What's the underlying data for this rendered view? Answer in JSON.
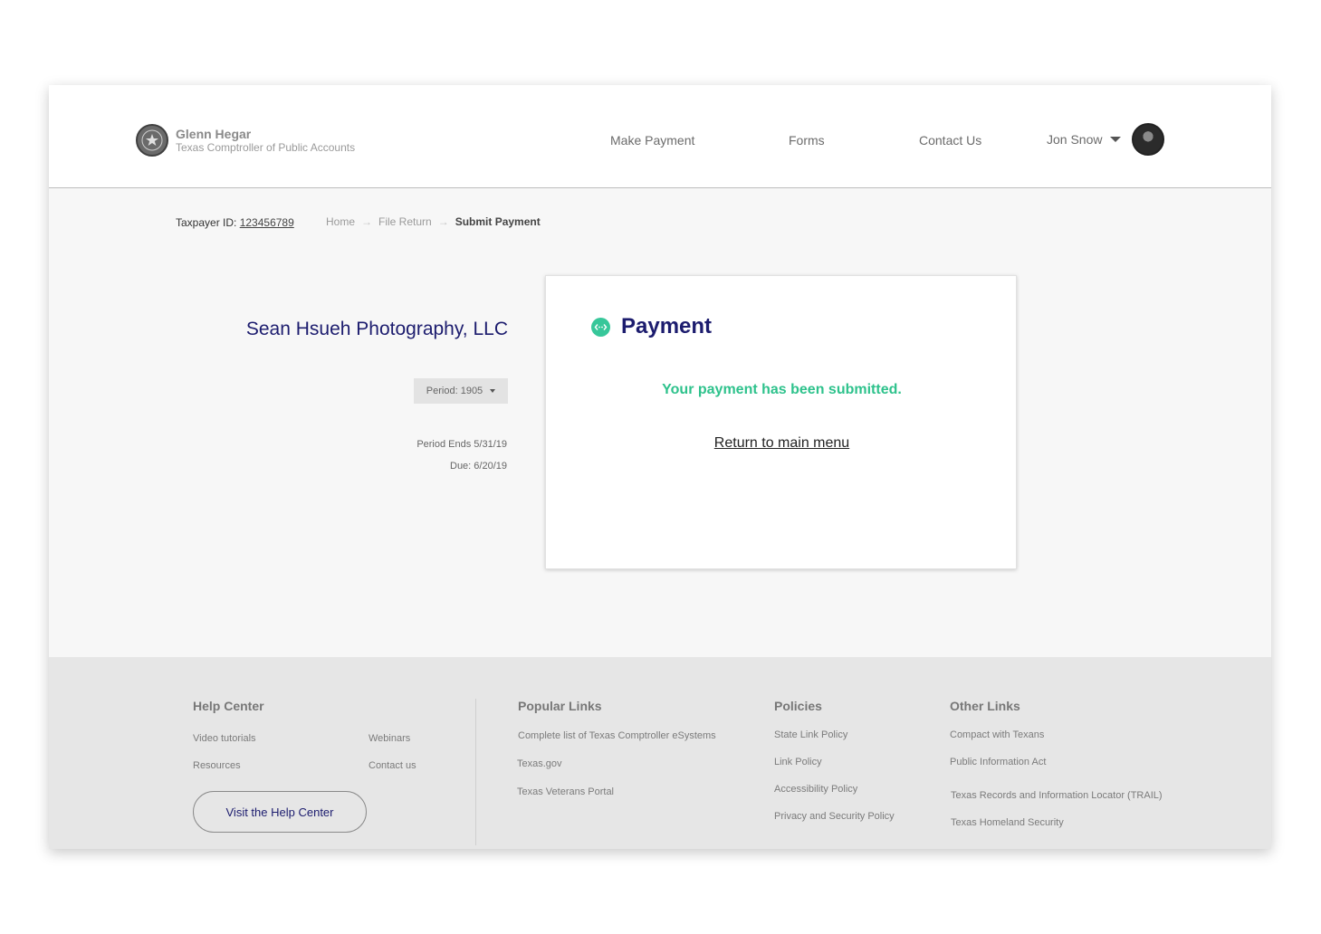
{
  "header": {
    "brand_name": "Glenn Hegar",
    "brand_sub": "Texas Comptroller of Public Accounts",
    "nav": [
      "Make Payment",
      "Forms",
      "Contact Us"
    ],
    "user_name": "Jon Snow"
  },
  "breadcrumb": {
    "taxpayer_label": "Taxpayer ID:",
    "taxpayer_id": "123456789",
    "items": [
      "Home",
      "File Return"
    ],
    "current": "Submit Payment"
  },
  "account": {
    "company": "Sean Hsueh Photography, LLC",
    "period_label": "Period: 1905",
    "period_ends": "Period Ends 5/31/19",
    "due": "Due: 6/20/19"
  },
  "card": {
    "title": "Payment",
    "success_message": "Your payment has been submitted.",
    "return_link": "Return to main menu"
  },
  "footer": {
    "help_center": {
      "title": "Help Center",
      "links": [
        "Video tutorials",
        "Webinars",
        "Resources",
        "Contact us"
      ],
      "button": "Visit the Help Center"
    },
    "popular_links": {
      "title": "Popular Links",
      "links": [
        "Complete list of Texas Comptroller eSystems",
        "Texas.gov",
        "Texas Veterans Portal"
      ]
    },
    "policies": {
      "title": "Policies",
      "links": [
        "State Link Policy",
        "Link Policy",
        "Accessibility Policy",
        "Privacy and Security Policy"
      ]
    },
    "other_links": {
      "title": "Other Links",
      "links": [
        "Compact with Texans",
        "Public Information Act",
        "Texas Records and Information Locator (TRAIL)",
        "Texas Homeland Security"
      ]
    }
  },
  "colors": {
    "navy": "#1c1c6e",
    "success_green": "#2ec28c"
  }
}
